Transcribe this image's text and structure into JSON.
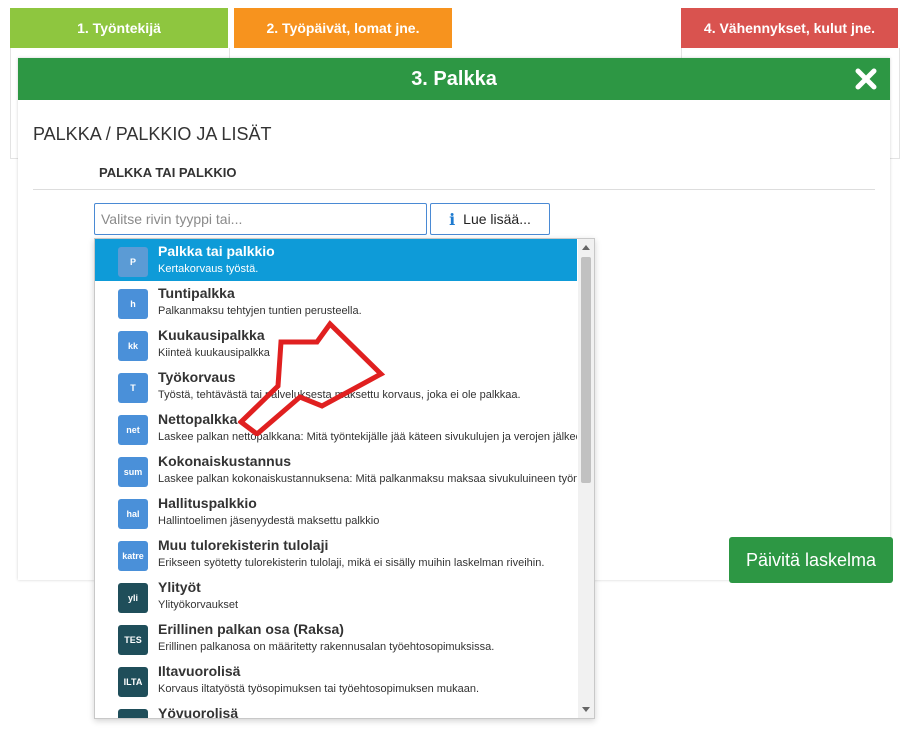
{
  "tabs": [
    {
      "label": "1. Työntekijä",
      "color": "#8ec63f"
    },
    {
      "label": "2. Työpäivät, lomat jne.",
      "color": "#f7931e"
    },
    {
      "label": "4. Vähennykset, kulut jne.",
      "color": "#d9534f"
    }
  ],
  "modal": {
    "title": "3. Palkka",
    "header_color": "#2d9744",
    "section_title": "PALKKA / PALKKIO JA LISÄT",
    "sub_title": "PALKKA TAI PALKKIO"
  },
  "search": {
    "placeholder": "Valitse rivin tyyppi tai..."
  },
  "info_button": {
    "label": "Lue lisää..."
  },
  "update_button": {
    "label": "Päivitä laskelma"
  },
  "dropdown": {
    "items": [
      {
        "badge": "P",
        "title": "Palkka tai palkkio",
        "desc": "Kertakorvaus työstä.",
        "badge_color": "#5b9bd5",
        "selected": true
      },
      {
        "badge": "h",
        "title": "Tuntipalkka",
        "desc": "Palkanmaksu tehtyjen tuntien perusteella.",
        "badge_color": "#4a90d9"
      },
      {
        "badge": "kk",
        "title": "Kuukausipalkka",
        "desc": "Kiinteä kuukausipalkka",
        "badge_color": "#4a90d9"
      },
      {
        "badge": "T",
        "title": "Työkorvaus",
        "desc": "Työstä, tehtävästä tai palveluksesta maksettu korvaus, joka ei ole palkkaa.",
        "badge_color": "#4a90d9"
      },
      {
        "badge": "net",
        "title": "Nettopalkka",
        "desc": "Laskee palkan nettopalkkana: Mitä työntekijälle jää käteen sivukulujen ja verojen jälkeen.",
        "badge_color": "#4a90d9"
      },
      {
        "badge": "sum",
        "title": "Kokonaiskustannus",
        "desc": "Laskee palkan kokonaiskustannuksena: Mitä palkanmaksu maksaa sivukuluineen työnantajalle.",
        "badge_color": "#4a90d9"
      },
      {
        "badge": "hal",
        "title": "Hallituspalkkio",
        "desc": "Hallintoelimen jäsenyydestä maksettu palkkio",
        "badge_color": "#4a90d9"
      },
      {
        "badge": "katre",
        "title": "Muu tulorekisterin tulolaji",
        "desc": "Erikseen syötetty tulorekisterin tulolaji, mikä ei sisälly muihin laskelman riveihin.",
        "badge_color": "#4a90d9"
      },
      {
        "badge": "yli",
        "title": "Ylityöt",
        "desc": "Ylityökorvaukset",
        "badge_color": "#1f4e5a"
      },
      {
        "badge": "TES",
        "title": "Erillinen palkan osa (Raksa)",
        "desc": "Erillinen palkanosa on määritetty rakennusalan työehtosopimuksissa.",
        "badge_color": "#1f4e5a"
      },
      {
        "badge": "ILTA",
        "title": "Iltavuorolisä",
        "desc": "Korvaus iltatyöstä työsopimuksen tai työehtosopimuksen mukaan.",
        "badge_color": "#1f4e5a"
      },
      {
        "badge": "YÖ",
        "title": "Yövuorolisä",
        "desc": "",
        "badge_color": "#1f4e5a"
      }
    ]
  },
  "annotation": {
    "arrow_color": "#e02020"
  }
}
